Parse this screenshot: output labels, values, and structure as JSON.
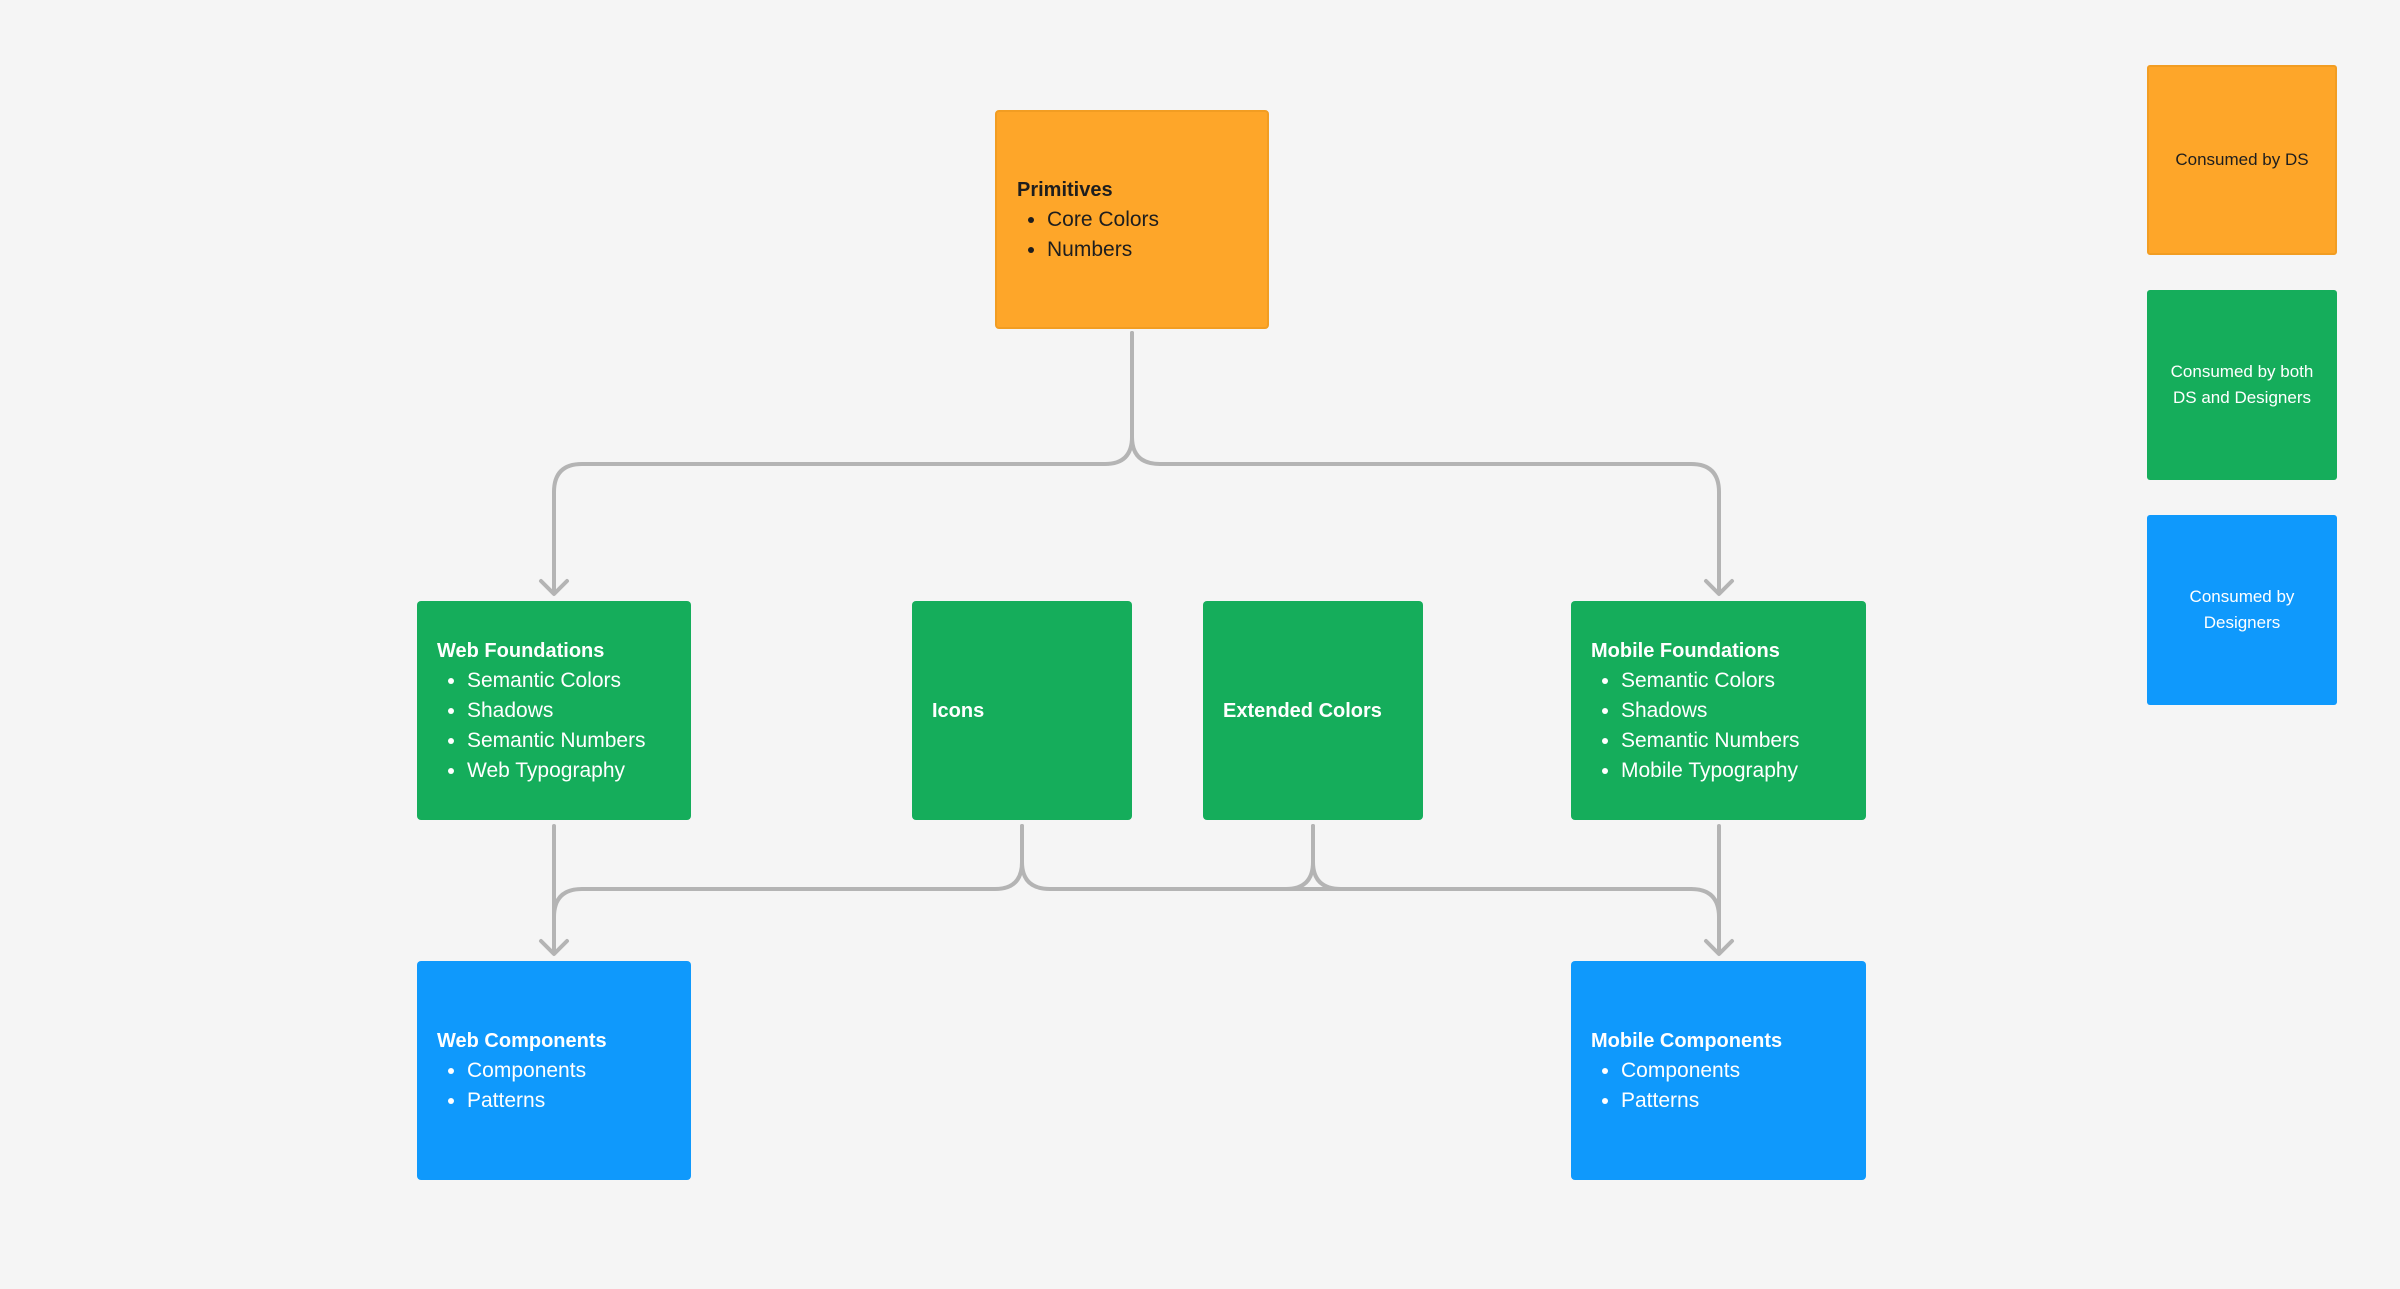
{
  "colors": {
    "background": "#f5f5f5",
    "ds_only": "#fea629",
    "both": "#15ad5b",
    "designers": "#0f99fc",
    "connector": "#b4b4b4"
  },
  "nodes": {
    "primitives": {
      "title": "Primitives",
      "items": [
        "Core Colors",
        "Numbers"
      ]
    },
    "web_foundations": {
      "title": "Web Foundations",
      "items": [
        "Semantic Colors",
        "Shadows",
        "Semantic Numbers",
        "Web Typography"
      ]
    },
    "icons": {
      "title": "Icons"
    },
    "extended_colors": {
      "title": "Extended Colors"
    },
    "mobile_foundations": {
      "title": "Mobile Foundations",
      "items": [
        "Semantic Colors",
        "Shadows",
        "Semantic Numbers",
        "Mobile Typography"
      ]
    },
    "web_components": {
      "title": "Web Components",
      "items": [
        "Components",
        "Patterns"
      ]
    },
    "mobile_components": {
      "title": "Mobile Components",
      "items": [
        "Components",
        "Patterns"
      ]
    }
  },
  "legend": {
    "ds": "Consumed by DS",
    "both": "Consumed by both DS and Designers",
    "designers": "Consumed by Designers"
  },
  "edges": [
    {
      "from": "Primitives",
      "to": "Web Foundations"
    },
    {
      "from": "Primitives",
      "to": "Mobile Foundations"
    },
    {
      "from": "Web Foundations",
      "to": "Web Components"
    },
    {
      "from": "Icons",
      "to": "Web Components"
    },
    {
      "from": "Icons",
      "to": "Mobile Components"
    },
    {
      "from": "Extended Colors",
      "to": "Web Components"
    },
    {
      "from": "Extended Colors",
      "to": "Mobile Components"
    },
    {
      "from": "Mobile Foundations",
      "to": "Mobile Components"
    }
  ]
}
